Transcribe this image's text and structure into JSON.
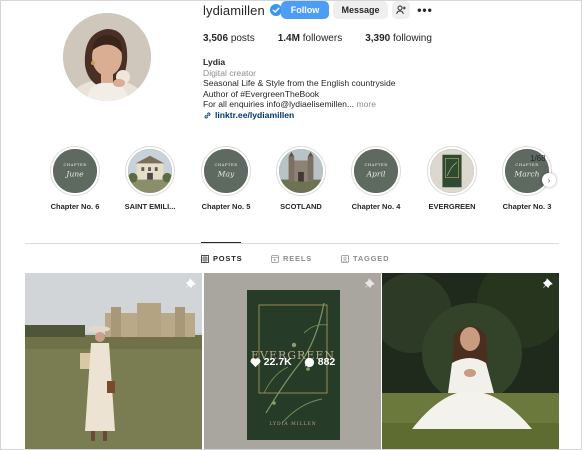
{
  "profile": {
    "username": "lydiamillen",
    "follow_label": "Follow",
    "message_label": "Message",
    "add_user_label": "+",
    "more_label": "•••"
  },
  "stats": {
    "posts_count": "3,506",
    "posts_label": "posts",
    "followers_count": "1.4M",
    "followers_label": "followers",
    "following_count": "3,390",
    "following_label": "following"
  },
  "bio": {
    "name": "Lydia",
    "category": "Digital creator",
    "line1": "Seasonal Life & Style from the English countryside",
    "line2": "Author of #EvergreenTheBook",
    "line3": "For all enquiries info@lydiaelisemillen...",
    "more": "more",
    "link": "linktr.ee/lydiamillen"
  },
  "highlights": {
    "items": [
      {
        "label": "Chapter No. 6",
        "cover_top": "CHAPTER",
        "cover_main": "June"
      },
      {
        "label": "SAINT EMILI..."
      },
      {
        "label": "Chapter No. 5",
        "cover_top": "CHAPTER",
        "cover_main": "May"
      },
      {
        "label": "SCOTLAND"
      },
      {
        "label": "Chapter No. 4",
        "cover_top": "CHAPTER",
        "cover_main": "April"
      },
      {
        "label": "EVERGREEN"
      },
      {
        "label": "Chapter No. 3",
        "cover_top": "CHAPTER",
        "cover_main": "March"
      }
    ],
    "counter": "1/68"
  },
  "tabs": [
    {
      "label": "POSTS",
      "icon": "grid-icon"
    },
    {
      "label": "REELS",
      "icon": "reels-icon"
    },
    {
      "label": "TAGGED",
      "icon": "tagged-icon"
    }
  ],
  "posts": [
    {
      "pinned": true
    },
    {
      "pinned": true,
      "likes": "22.7K",
      "comments": "882",
      "book_title": "EVERGREEN",
      "book_author": "LYDIA MILLEN"
    },
    {
      "pinned": true
    }
  ],
  "colors": {
    "follow_button": "#4c9df5",
    "link": "#00376b",
    "highlight_cover": "#5e6a60",
    "book_green": "#2f4a33"
  }
}
